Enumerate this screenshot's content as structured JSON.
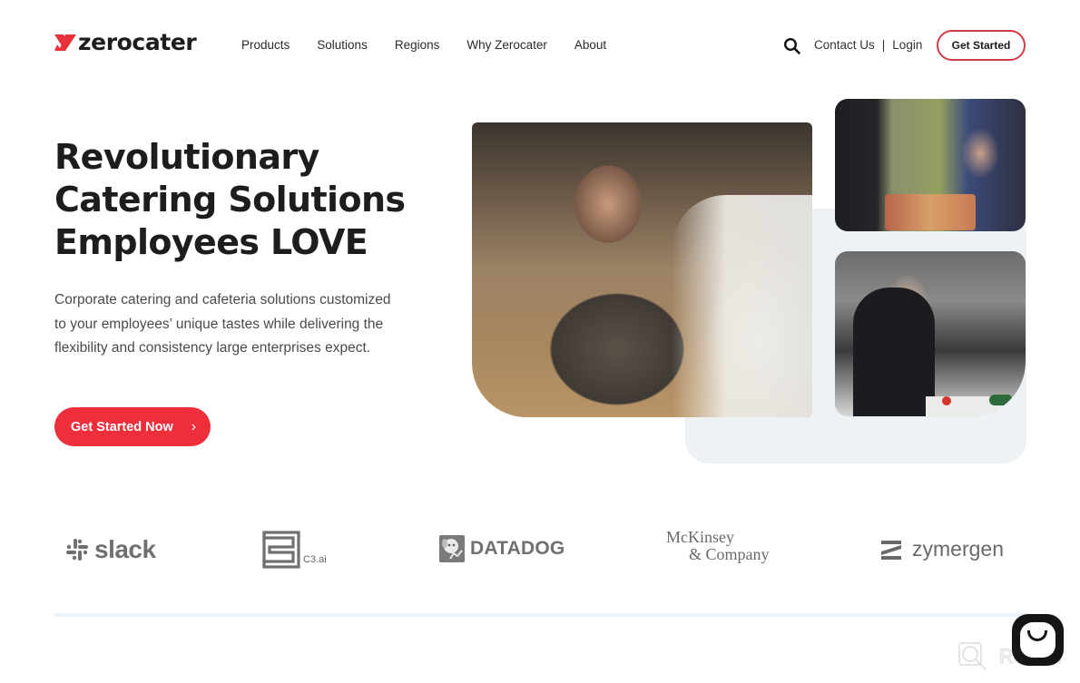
{
  "brand": {
    "name": "zerocater",
    "accent_color": "#ee2e3b"
  },
  "nav": {
    "items": [
      "Products",
      "Solutions",
      "Regions",
      "Why Zerocater",
      "About"
    ]
  },
  "header_utils": {
    "search_icon": "search-icon",
    "contact_label": "Contact Us",
    "separator": "|",
    "login_label": "Login",
    "cta_label": "Get Started"
  },
  "hero": {
    "headline_lines": [
      "Revolutionary",
      "Catering Solutions",
      "Employees LOVE"
    ],
    "subtext": "Corporate catering and cafeteria solutions customized to your employees’ unique tastes while delivering the flexibility and consistency large enterprises expect.",
    "cta_label": "Get Started Now",
    "cta_icon": "›",
    "images": [
      {
        "name": "cafeteria-diners-photo"
      },
      {
        "name": "food-service-counter-photo"
      },
      {
        "name": "chef-cutting-photo"
      }
    ]
  },
  "client_logos": [
    {
      "name": "slack",
      "text": "slack"
    },
    {
      "name": "c3ai",
      "text": "C3.ai"
    },
    {
      "name": "datadog",
      "text": "DATADOG"
    },
    {
      "name": "mckinsey",
      "line1": "McKinsey",
      "line2": "& Company"
    },
    {
      "name": "zymergen",
      "text": "zymergen"
    }
  ],
  "chat_widget": {
    "icon": "chat-smile-icon"
  },
  "watermark": {
    "text": "Revain"
  }
}
